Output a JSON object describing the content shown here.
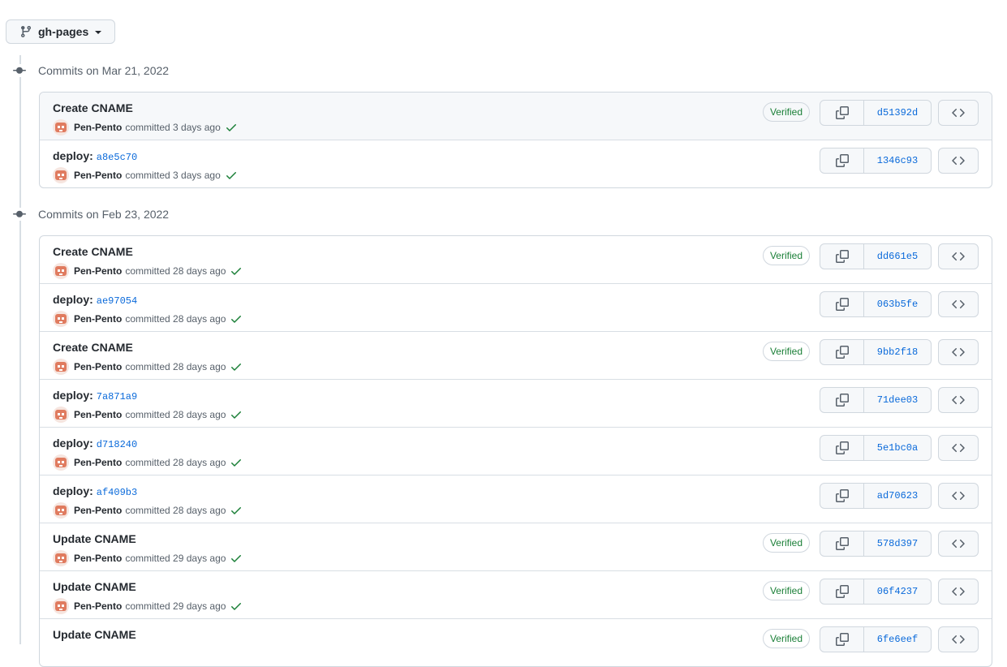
{
  "branch": {
    "label": "gh-pages",
    "icon": "git-branch-icon"
  },
  "colors": {
    "verified": "#1a7f37",
    "link": "#0969da",
    "border": "#d0d7de",
    "avatar": "#e07b5f"
  },
  "days": [
    {
      "heading": "Commits on Mar 21, 2022",
      "commits": [
        {
          "title": "Create CNAME",
          "ref_label": "",
          "ref_sha": "",
          "author": "Pen-Pento",
          "action": "committed",
          "time": "3 days ago",
          "verified": "Verified",
          "sha": "d51392d"
        },
        {
          "title": "deploy:",
          "ref_label": "",
          "ref_sha": "a8e5c70",
          "author": "Pen-Pento",
          "action": "committed",
          "time": "3 days ago",
          "verified": "",
          "sha": "1346c93"
        }
      ]
    },
    {
      "heading": "Commits on Feb 23, 2022",
      "commits": [
        {
          "title": "Create CNAME",
          "ref_sha": "",
          "author": "Pen-Pento",
          "action": "committed",
          "time": "28 days ago",
          "verified": "Verified",
          "sha": "dd661e5"
        },
        {
          "title": "deploy:",
          "ref_sha": "ae97054",
          "author": "Pen-Pento",
          "action": "committed",
          "time": "28 days ago",
          "verified": "",
          "sha": "063b5fe"
        },
        {
          "title": "Create CNAME",
          "ref_sha": "",
          "author": "Pen-Pento",
          "action": "committed",
          "time": "28 days ago",
          "verified": "Verified",
          "sha": "9bb2f18"
        },
        {
          "title": "deploy:",
          "ref_sha": "7a871a9",
          "author": "Pen-Pento",
          "action": "committed",
          "time": "28 days ago",
          "verified": "",
          "sha": "71dee03"
        },
        {
          "title": "deploy:",
          "ref_sha": "d718240",
          "author": "Pen-Pento",
          "action": "committed",
          "time": "28 days ago",
          "verified": "",
          "sha": "5e1bc0a"
        },
        {
          "title": "deploy:",
          "ref_sha": "af409b3",
          "author": "Pen-Pento",
          "action": "committed",
          "time": "28 days ago",
          "verified": "",
          "sha": "ad70623"
        },
        {
          "title": "Update CNAME",
          "ref_sha": "",
          "author": "Pen-Pento",
          "action": "committed",
          "time": "29 days ago",
          "verified": "Verified",
          "sha": "578d397"
        },
        {
          "title": "Update CNAME",
          "ref_sha": "",
          "author": "Pen-Pento",
          "action": "committed",
          "time": "29 days ago",
          "verified": "Verified",
          "sha": "06f4237"
        },
        {
          "title": "Update CNAME",
          "ref_sha": "",
          "author": "",
          "action": "",
          "time": "",
          "verified": "Verified",
          "sha": "6fe6eef"
        }
      ]
    }
  ]
}
